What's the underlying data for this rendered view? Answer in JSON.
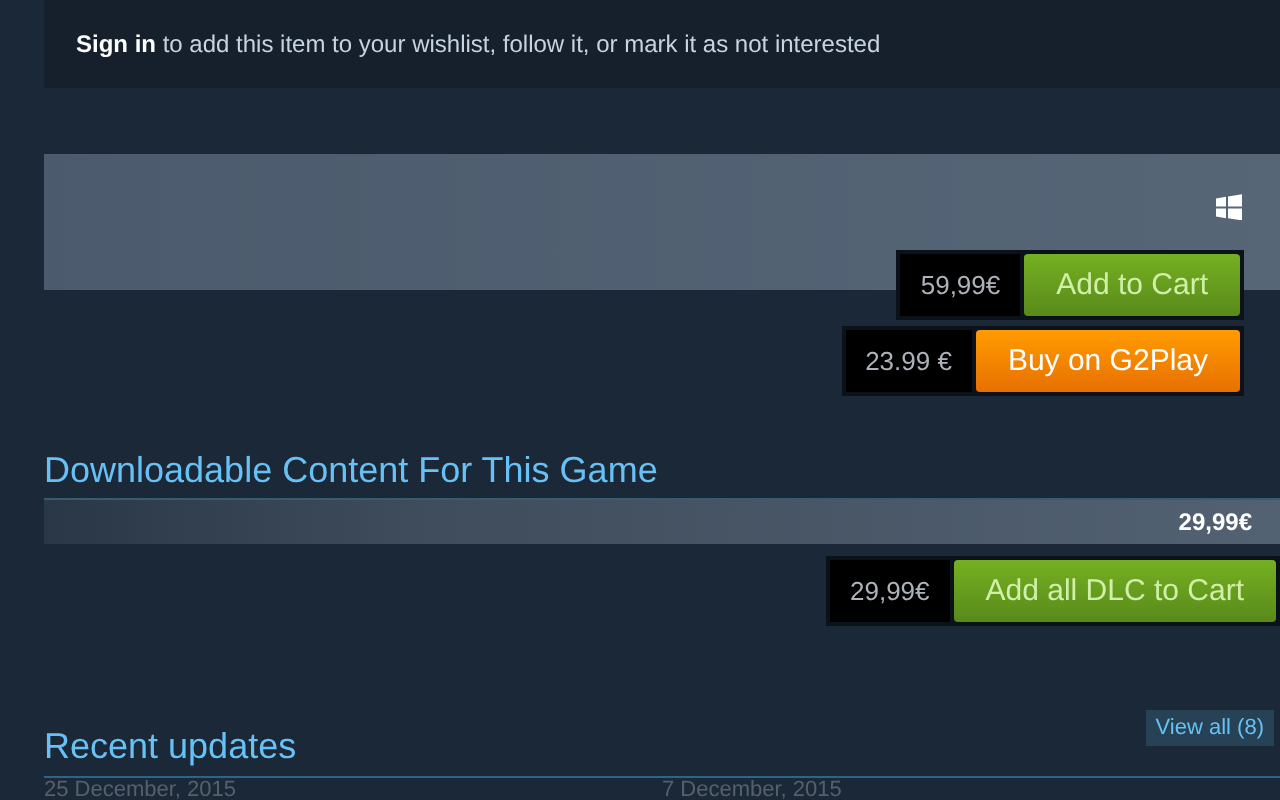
{
  "sign_in_notice": "**Sign in** to add this item to your wishlist, follow it, or mark it as not interested",
  "purchase": [
    {
      "kind": "steam",
      "price": "59,99€",
      "button": "Add to Cart"
    },
    {
      "kind": "g2play",
      "price": "23.99 €",
      "button": "Buy on G2Play"
    }
  ],
  "dlc": {
    "title": "Downloadable Content For This Game",
    "total": "29,99€",
    "price": "29,99€",
    "button": "Add all DLC to Cart"
  },
  "updates": {
    "title": "Recent updates",
    "view_all": "View all (8)",
    "dates": [
      "25 December, 2015",
      "7 December, 2015"
    ]
  }
}
